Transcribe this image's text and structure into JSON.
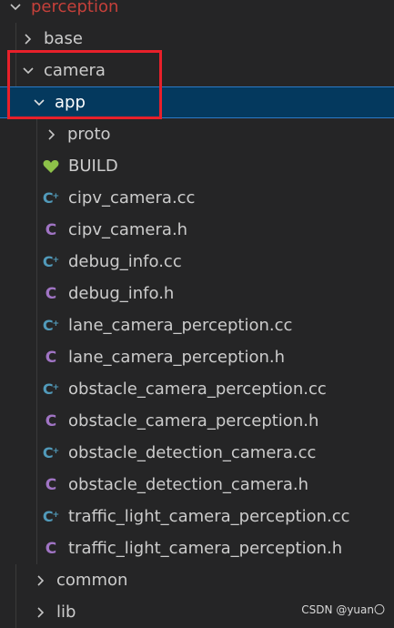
{
  "explorer": {
    "root": {
      "label": "perception",
      "expanded": true
    },
    "folders": {
      "base": "base",
      "camera": "camera",
      "app": "app",
      "proto": "proto",
      "common": "common",
      "lib": "lib"
    },
    "files": [
      {
        "label": "BUILD",
        "icon": "heart-icon"
      },
      {
        "label": "cipv_camera.cc",
        "icon": "cpp-icon"
      },
      {
        "label": "cipv_camera.h",
        "icon": "c-header-icon"
      },
      {
        "label": "debug_info.cc",
        "icon": "cpp-icon"
      },
      {
        "label": "debug_info.h",
        "icon": "c-header-icon"
      },
      {
        "label": "lane_camera_perception.cc",
        "icon": "cpp-icon"
      },
      {
        "label": "lane_camera_perception.h",
        "icon": "c-header-icon"
      },
      {
        "label": "obstacle_camera_perception.cc",
        "icon": "cpp-icon"
      },
      {
        "label": "obstacle_camera_perception.h",
        "icon": "c-header-icon"
      },
      {
        "label": "obstacle_detection_camera.cc",
        "icon": "cpp-icon"
      },
      {
        "label": "obstacle_detection_camera.h",
        "icon": "c-header-icon"
      },
      {
        "label": "traffic_light_camera_perception.cc",
        "icon": "cpp-icon"
      },
      {
        "label": "traffic_light_camera_perception.h",
        "icon": "c-header-icon"
      }
    ],
    "selected": "app",
    "colors": {
      "background": "#252526",
      "selection": "#04395e",
      "selection_border": "#2c7ac6",
      "root_text": "#c5403a",
      "cpp_icon": "#519aba",
      "header_icon": "#a074c4",
      "build_icon": "#8dc149",
      "annotation_box": "#e8202a"
    }
  },
  "watermark": "CSDN @yuan〇"
}
